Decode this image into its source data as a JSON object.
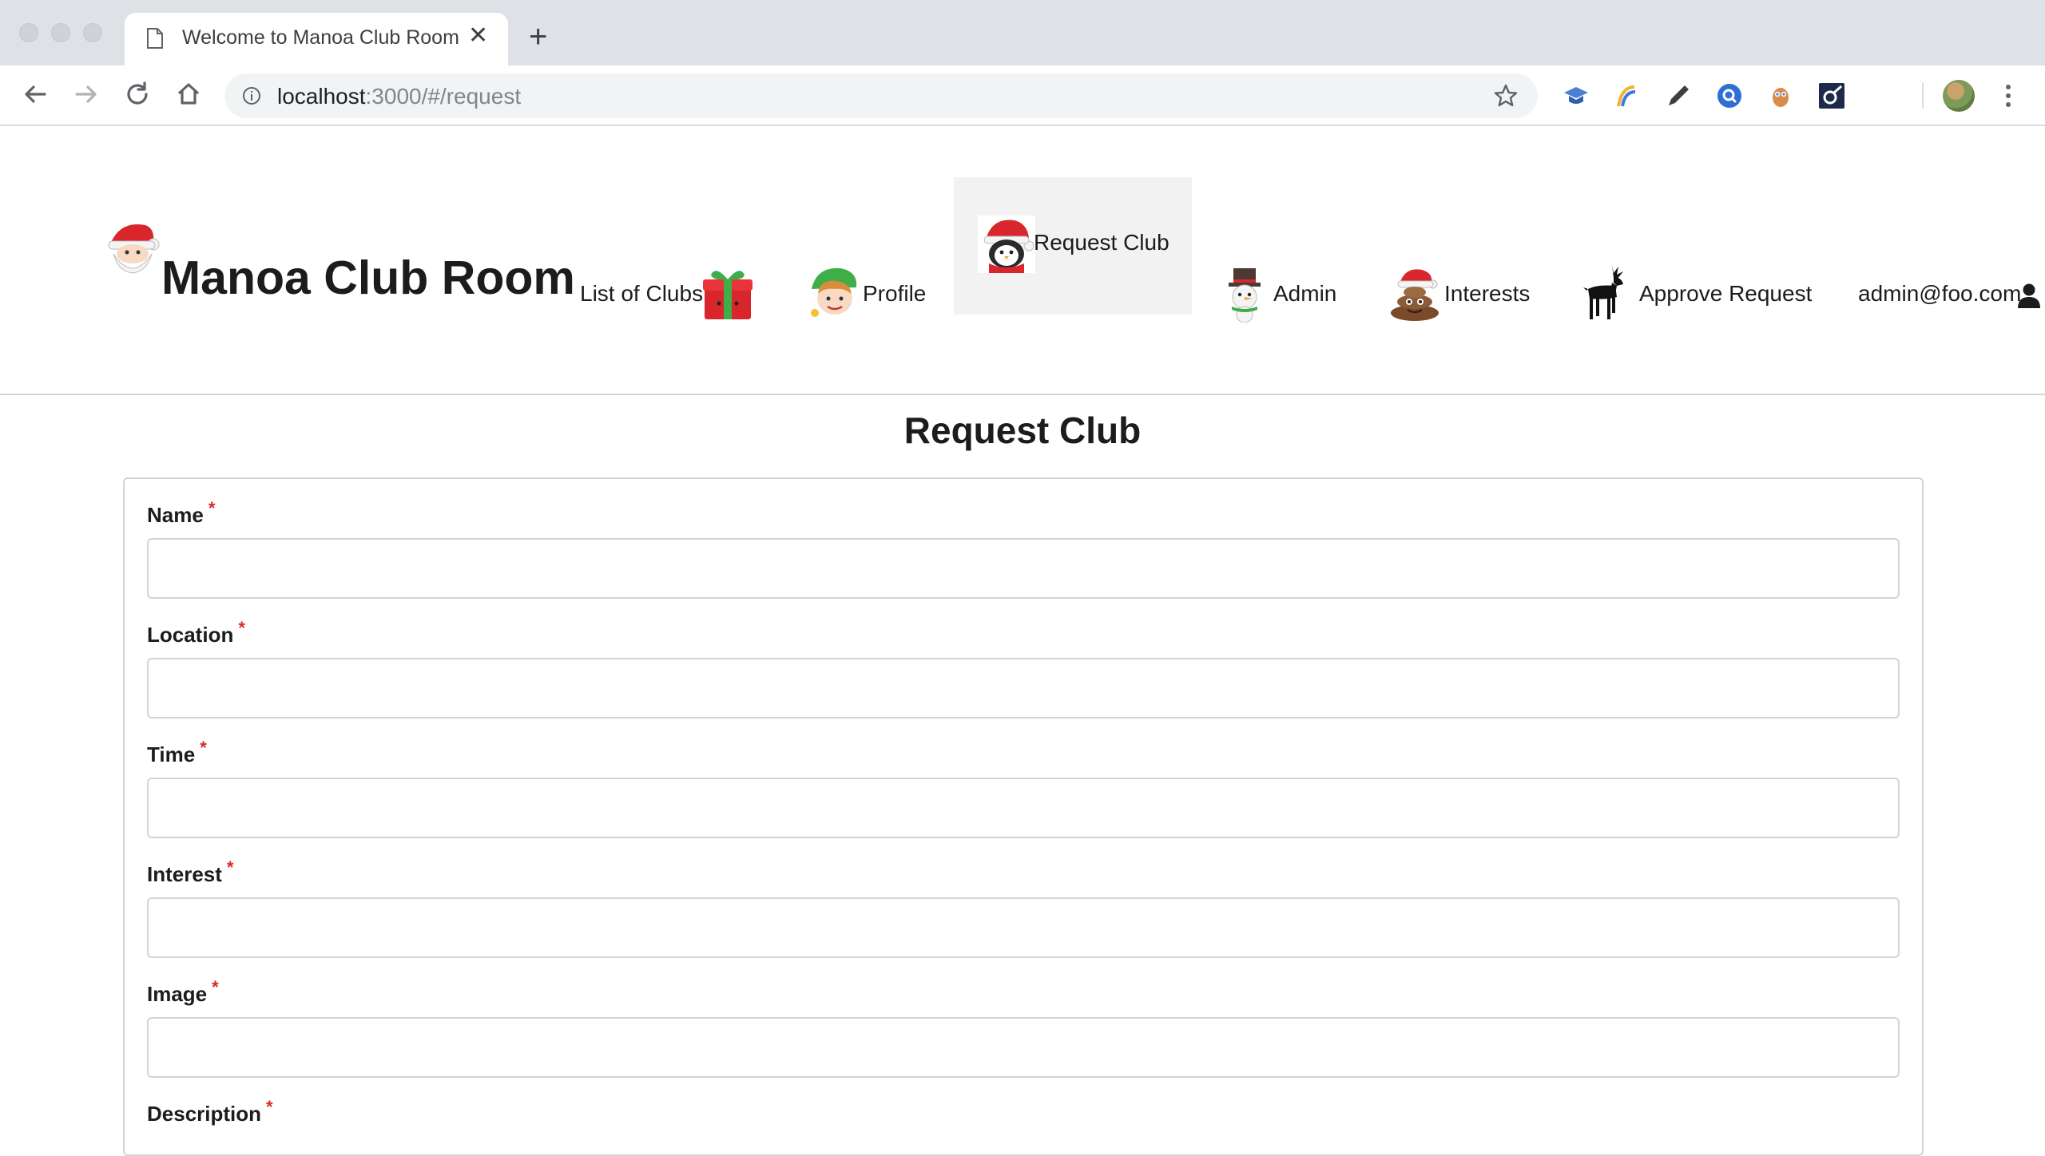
{
  "browser": {
    "tab_title": "Welcome to Manoa Club Room",
    "url_host": "localhost",
    "url_path": ":3000/#/request"
  },
  "nav": {
    "brand": "Manoa Club Room",
    "items": [
      {
        "label": "List of Clubs",
        "icon": "gift-icon"
      },
      {
        "label": "Profile",
        "icon": "elf-icon"
      },
      {
        "label": "Request Club",
        "icon": "penguin-santa-icon",
        "active": true
      },
      {
        "label": "Admin",
        "icon": "snowman-icon"
      },
      {
        "label": "Interests",
        "icon": "poop-santa-icon"
      },
      {
        "label": "Approve Request",
        "icon": "reindeer-icon"
      },
      {
        "label": "admin@foo.com",
        "icon": "user-icon"
      }
    ]
  },
  "page": {
    "title": "Request Club",
    "required_marker": "*",
    "fields": [
      {
        "label": "Name",
        "value": ""
      },
      {
        "label": "Location",
        "value": ""
      },
      {
        "label": "Time",
        "value": ""
      },
      {
        "label": "Interest",
        "value": ""
      },
      {
        "label": "Image",
        "value": ""
      },
      {
        "label": "Description",
        "value": ""
      }
    ]
  },
  "colors": {
    "required": "#db2828",
    "active_menu_bg": "#f2f2f2",
    "border": "#d4d4d5"
  }
}
